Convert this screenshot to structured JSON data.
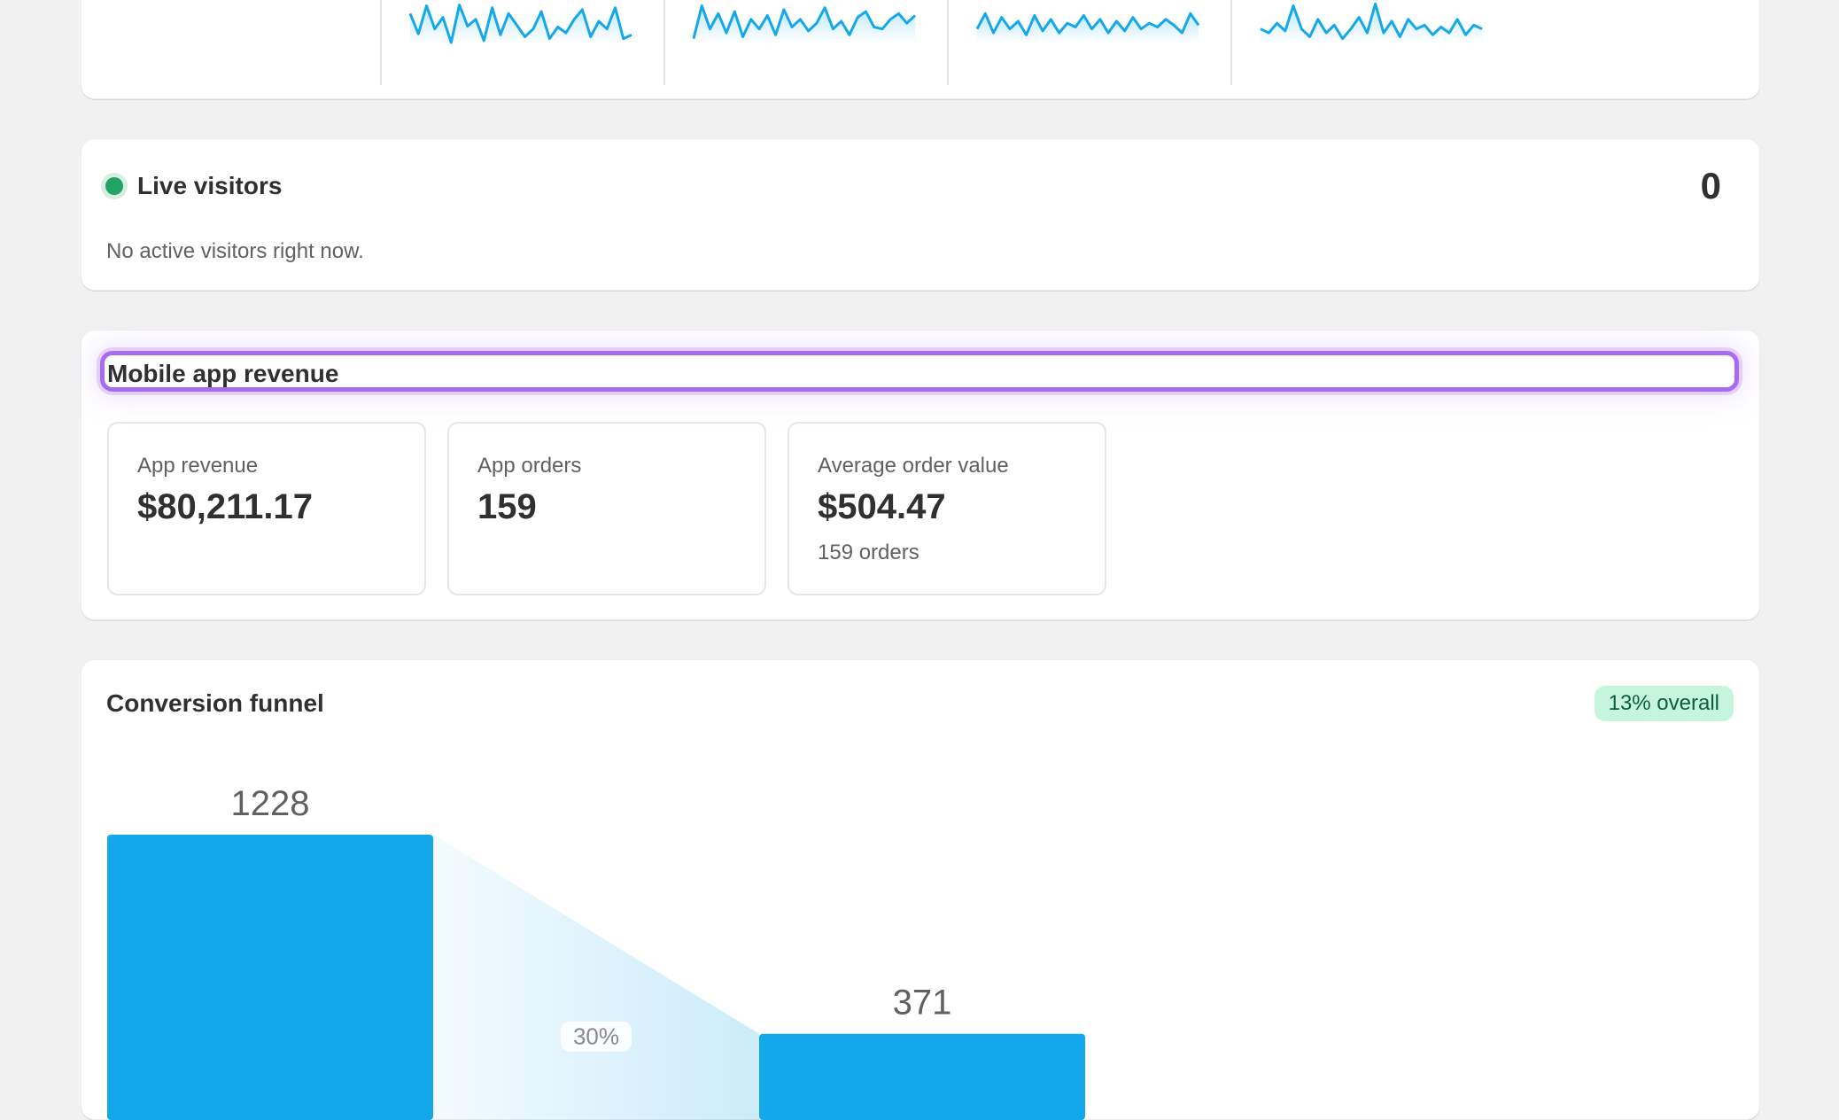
{
  "live": {
    "title": "Live visitors",
    "count": "0",
    "subtitle": "No active visitors right now."
  },
  "revenue": {
    "title": "Mobile app revenue",
    "metrics": [
      {
        "label": "App revenue",
        "value": "$80,211.17",
        "sub": ""
      },
      {
        "label": "App orders",
        "value": "159",
        "sub": ""
      },
      {
        "label": "Average order value",
        "value": "$504.47",
        "sub": "159 orders"
      }
    ]
  },
  "funnel": {
    "title": "Conversion funnel",
    "badge": "13% overall"
  },
  "colors": {
    "accent": "#13a8ea",
    "live_dot": "#21a366",
    "badge_bg": "#c5f5dd",
    "badge_text": "#0b5e39",
    "focus_ring": "#a86bf0"
  },
  "chart_data": [
    {
      "type": "bar",
      "categories": [
        "",
        ""
      ],
      "values": [
        1228,
        371
      ],
      "data_labels": [
        "1228",
        "371"
      ],
      "conversion_labels": [
        "30%"
      ],
      "title": "Conversion funnel",
      "xlabel": "",
      "ylabel": ""
    },
    {
      "type": "line",
      "values": [
        [
          14,
          35,
          6,
          30,
          18,
          44,
          5,
          27,
          20,
          42,
          8,
          36,
          14,
          26,
          38,
          30,
          12,
          40,
          28,
          34,
          20,
          10,
          38,
          22,
          30,
          8,
          40,
          36
        ],
        [
          40,
          6,
          30,
          14,
          34,
          12,
          38,
          20,
          30,
          16,
          36,
          10,
          28,
          20,
          32,
          24,
          8,
          30,
          22,
          36,
          18,
          12,
          28,
          30,
          20,
          14,
          24,
          16
        ],
        [
          30,
          14,
          34,
          18,
          30,
          22,
          36,
          16,
          32,
          20,
          34,
          24,
          28,
          16,
          30,
          20,
          34,
          22,
          32,
          18,
          30,
          24,
          28,
          20,
          26,
          34,
          14,
          26
        ],
        [
          30,
          34,
          24,
          32,
          6,
          30,
          38,
          20,
          34,
          26,
          40,
          30,
          18,
          34,
          4,
          34,
          22,
          38,
          20,
          30,
          26,
          36,
          28,
          34,
          20,
          36,
          26,
          30
        ]
      ]
    }
  ]
}
